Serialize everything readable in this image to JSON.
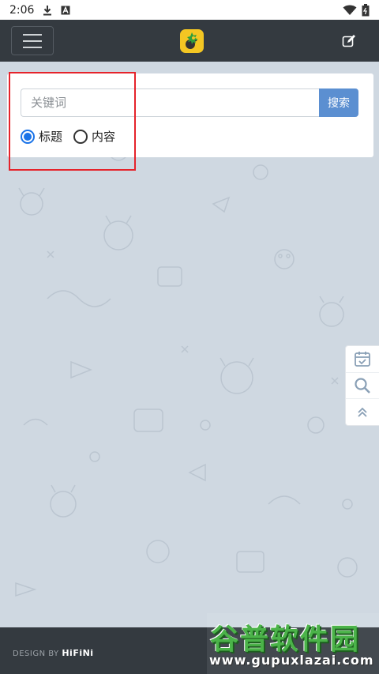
{
  "status_bar": {
    "time": "2:06",
    "icons": [
      "download-icon",
      "a-box-icon",
      "wifi-icon",
      "battery-icon"
    ]
  },
  "header": {
    "menu_icon": "hamburger-icon",
    "logo_icon": "app-logo",
    "edit_icon": "edit-icon",
    "background": "#343a40"
  },
  "search": {
    "placeholder": "关键词",
    "value": "",
    "button_label": "搜索",
    "button_color": "#5b8fd1",
    "options": [
      {
        "label": "标题",
        "checked": true
      },
      {
        "label": "内容",
        "checked": false
      }
    ]
  },
  "side_tools": {
    "items": [
      "calendar-check-icon",
      "search-icon",
      "double-chevron-up-icon"
    ]
  },
  "footer": {
    "prefix": "DESIGN BY",
    "brand": "HiFiNi"
  },
  "watermark": {
    "title": "谷普软件园",
    "url": "www.gupuxlazai.com"
  },
  "colors": {
    "highlight": "#e5232b",
    "radio_accent": "#1a73e8",
    "page_bg": "#cfd8e1"
  }
}
